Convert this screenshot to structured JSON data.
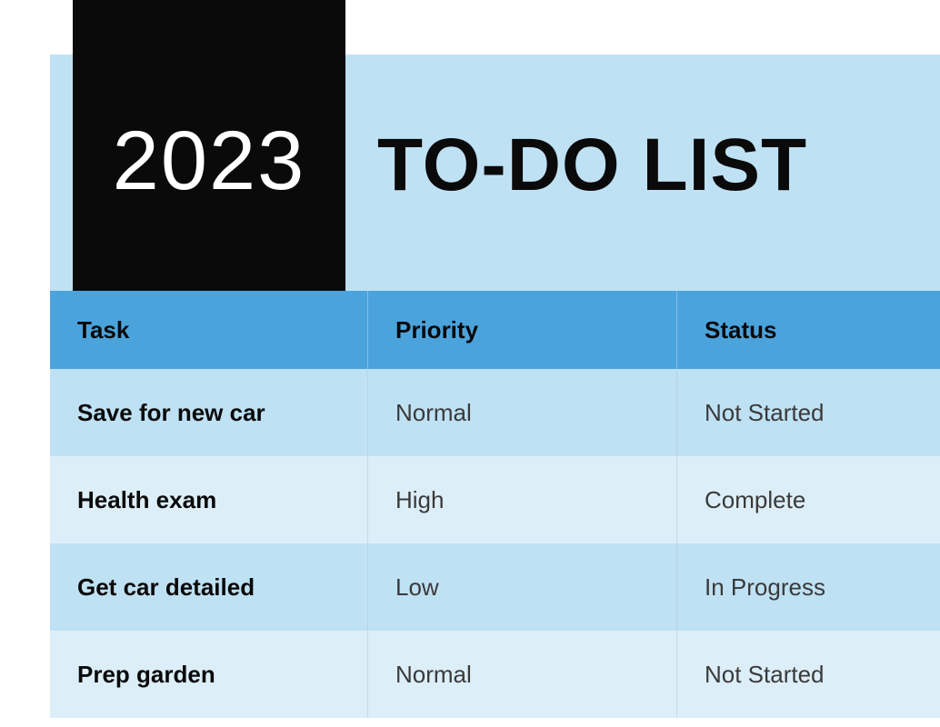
{
  "header": {
    "year": "2023",
    "title": "TO-DO LIST"
  },
  "table": {
    "columns": {
      "task": "Task",
      "priority": "Priority",
      "status": "Status"
    },
    "rows": [
      {
        "task": "Save for new car",
        "priority": "Normal",
        "status": "Not Started"
      },
      {
        "task": "Health exam",
        "priority": "High",
        "status": "Complete"
      },
      {
        "task": "Get car detailed",
        "priority": "Low",
        "status": "In Progress"
      },
      {
        "task": "Prep garden",
        "priority": "Normal",
        "status": "Not Started"
      }
    ]
  },
  "colors": {
    "banner": "#bfe1f4",
    "year_box": "#0a0a0a",
    "header_row": "#4ba3dc",
    "row_alt1": "#bfe1f4",
    "row_alt2": "#dceef8"
  }
}
